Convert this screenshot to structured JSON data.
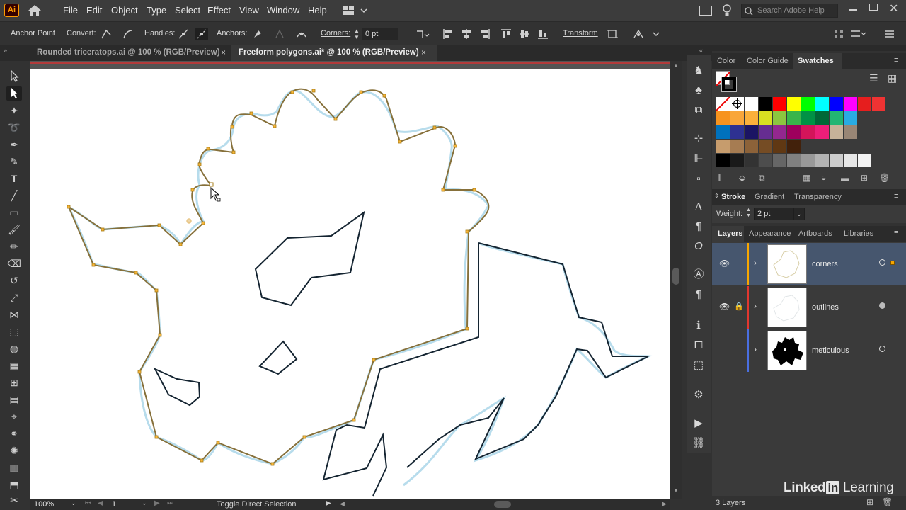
{
  "app": {
    "logo": "Ai"
  },
  "menu": [
    "File",
    "Edit",
    "Object",
    "Type",
    "Select",
    "Effect",
    "View",
    "Window",
    "Help"
  ],
  "search": {
    "placeholder": "Search Adobe Help"
  },
  "control": {
    "anchor_point": "Anchor Point",
    "convert": "Convert:",
    "handles": "Handles:",
    "anchors": "Anchors:",
    "corners": "Corners:",
    "corners_value": "0 pt",
    "transform": "Transform"
  },
  "tabs": [
    {
      "label": "Rounded triceratops.ai @ 100 % (RGB/Preview)",
      "close": "×"
    },
    {
      "label": "Freeform polygons.ai* @ 100 % (RGB/Preview)",
      "close": "×"
    }
  ],
  "status": {
    "zoom": "100%",
    "artboard": "1",
    "info": "Toggle Direct Selection"
  },
  "swatches_panel": {
    "tabs": [
      "Color",
      "Color Guide",
      "Swatches"
    ],
    "colors": [
      [
        "#ffffff",
        "#000000",
        "#ff0000",
        "#ffff00",
        "#00ff00",
        "#00ffff",
        "#0000ff",
        "#ff00ff",
        "#e61e1e",
        "#ee3333"
      ],
      [
        "#f7931e",
        "#f9a63a",
        "#fbb03b",
        "#d9e021",
        "#8cc63f",
        "#39b54a",
        "#009245",
        "#006837",
        "#22b573",
        "#29abe2"
      ],
      [
        "#0071bc",
        "#2e3192",
        "#1b1464",
        "#662d91",
        "#93278f",
        "#9e005d",
        "#d4145a",
        "#ed1e79",
        "#c7b299",
        "#998675"
      ],
      [
        "#c69c6d",
        "#a67c52",
        "#8c6239",
        "#754c24",
        "#603813",
        "#42210b"
      ],
      [
        "#000000",
        "#1a1a1a",
        "#333333",
        "#4d4d4d",
        "#666666",
        "#808080",
        "#999999",
        "#b3b3b3",
        "#cccccc",
        "#e6e6e6",
        "#f2f2f2"
      ]
    ]
  },
  "stroke_panel": {
    "tabs": [
      "Stroke",
      "Gradient",
      "Transparency"
    ],
    "weight_label": "Weight:",
    "weight_value": "2 pt"
  },
  "layers_panel": {
    "tabs": [
      "Layers",
      "Appearance",
      "Artboards",
      "Libraries"
    ],
    "layers": [
      {
        "name": "corners",
        "color": "#f7a600"
      },
      {
        "name": "outlines",
        "color": "#e2372f"
      },
      {
        "name": "meticulous",
        "color": "#4a6fe0"
      }
    ],
    "count": "3 Layers"
  },
  "watermark": {
    "text1": "Linked",
    "text2": "in",
    "text3": " Learning"
  }
}
